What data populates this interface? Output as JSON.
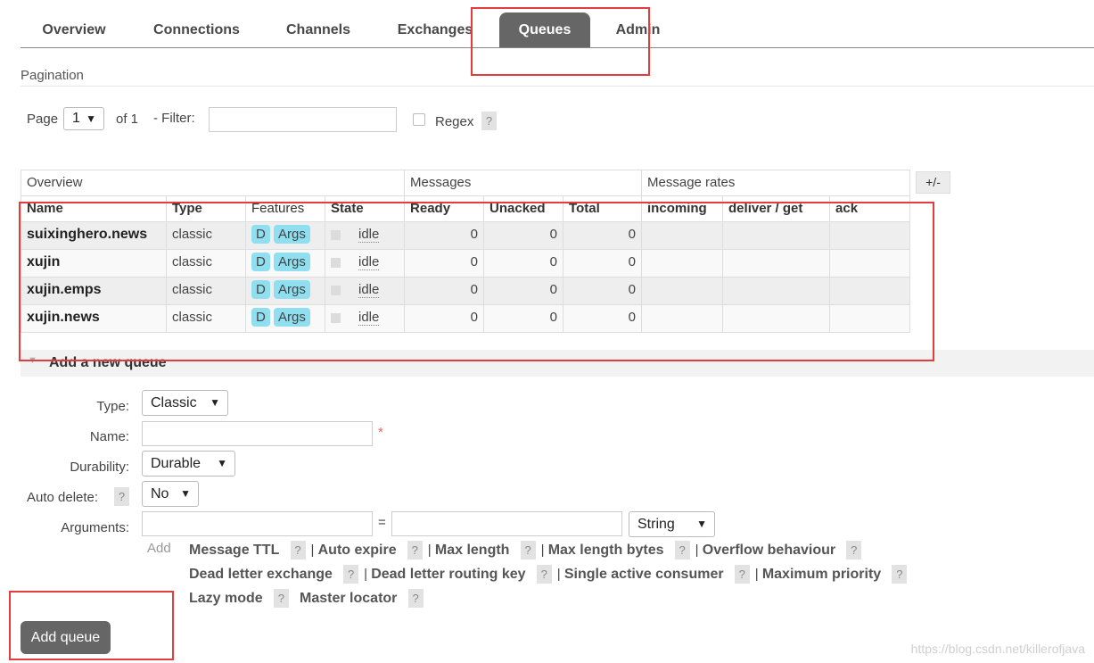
{
  "nav": {
    "tabs": [
      "Overview",
      "Connections",
      "Channels",
      "Exchanges",
      "Queues",
      "Admin"
    ],
    "active": "Queues"
  },
  "pagination": {
    "section_title": "Pagination",
    "page_label": "Page",
    "page_value": "1",
    "of_label": "of 1",
    "filter_label": "- Filter:",
    "filter_value": "",
    "regex_label": "Regex",
    "help": "?"
  },
  "table": {
    "groups": [
      "Overview",
      "Messages",
      "Message rates"
    ],
    "toggle_columns": "+/-",
    "columns": [
      "Name",
      "Type",
      "Features",
      "State",
      "Ready",
      "Unacked",
      "Total",
      "incoming",
      "deliver / get",
      "ack"
    ],
    "rows": [
      {
        "name": "suixinghero.news",
        "type": "classic",
        "features": [
          "D",
          "Args"
        ],
        "state": "idle",
        "ready": "0",
        "unacked": "0",
        "total": "0",
        "incoming": "",
        "deliver_get": "",
        "ack": ""
      },
      {
        "name": "xujin",
        "type": "classic",
        "features": [
          "D",
          "Args"
        ],
        "state": "idle",
        "ready": "0",
        "unacked": "0",
        "total": "0",
        "incoming": "",
        "deliver_get": "",
        "ack": ""
      },
      {
        "name": "xujin.emps",
        "type": "classic",
        "features": [
          "D",
          "Args"
        ],
        "state": "idle",
        "ready": "0",
        "unacked": "0",
        "total": "0",
        "incoming": "",
        "deliver_get": "",
        "ack": ""
      },
      {
        "name": "xujin.news",
        "type": "classic",
        "features": [
          "D",
          "Args"
        ],
        "state": "idle",
        "ready": "0",
        "unacked": "0",
        "total": "0",
        "incoming": "",
        "deliver_get": "",
        "ack": ""
      }
    ]
  },
  "add_queue": {
    "section_title": "Add a new queue",
    "type_label": "Type:",
    "type_value": "Classic",
    "name_label": "Name:",
    "name_value": "",
    "required_mark": "*",
    "durability_label": "Durability:",
    "durability_value": "Durable",
    "auto_delete_label": "Auto delete:",
    "auto_delete_value": "No",
    "arguments_label": "Arguments:",
    "arg_key": "",
    "equals": "=",
    "arg_value": "",
    "arg_type": "String",
    "add_label": "Add",
    "options_line1": [
      "Message TTL",
      "Auto expire",
      "Max length",
      "Max length bytes",
      "Overflow behaviour"
    ],
    "options_line2": [
      "Dead letter exchange",
      "Dead letter routing key",
      "Single active consumer",
      "Maximum priority"
    ],
    "options_line3": [
      "Lazy mode",
      "Master locator"
    ],
    "separator": "|",
    "submit_label": "Add queue"
  },
  "watermark": "https://blog.csdn.net/killerofjava",
  "colors": {
    "annotation_red": "#e33c3c",
    "tab_active": "#666666",
    "badge": "#8fdff0"
  }
}
